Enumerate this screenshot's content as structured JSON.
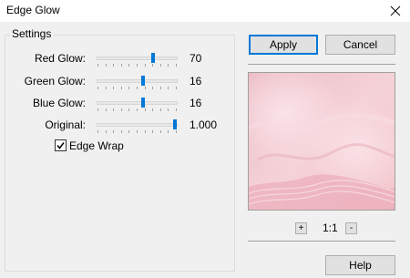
{
  "window": {
    "title": "Edge Glow",
    "close_icon": "close-icon"
  },
  "settings": {
    "group_label": "Settings",
    "sliders": [
      {
        "label": "Red Glow:",
        "value": "70",
        "level": 0.7
      },
      {
        "label": "Green Glow:",
        "value": "16",
        "level": 0.58
      },
      {
        "label": "Blue Glow:",
        "value": "16",
        "level": 0.58
      },
      {
        "label": "Original:",
        "value": "1.000",
        "level": 1.0
      }
    ],
    "edge_wrap": {
      "label": "Edge Wrap",
      "checked": true
    }
  },
  "buttons": {
    "apply": "Apply",
    "cancel": "Cancel",
    "help": "Help"
  },
  "zoom": {
    "plus": "+",
    "label": "1:1",
    "minus": "-"
  },
  "colors": {
    "accent": "#0078d7",
    "preview_base": "#f2c6ce"
  }
}
